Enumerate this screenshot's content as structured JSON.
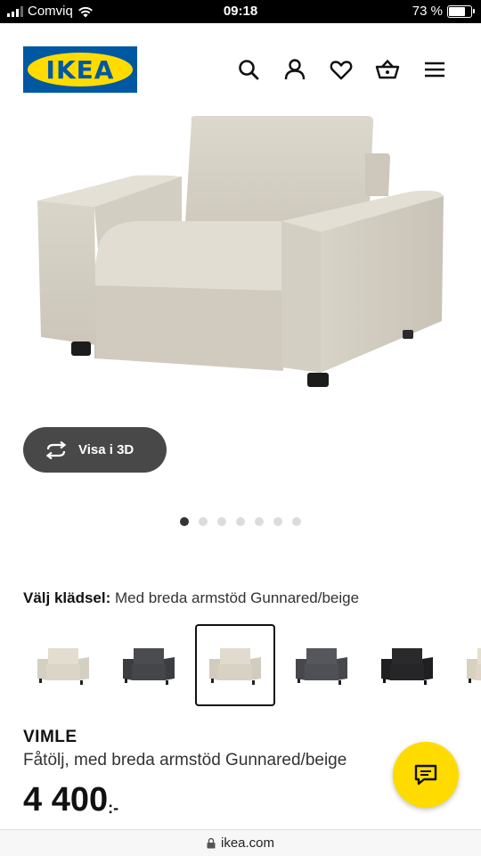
{
  "status_bar": {
    "carrier": "Comviq",
    "time": "09:18",
    "battery_percent": "73 %",
    "battery_level": 0.73
  },
  "header": {
    "logo_text": "IKEA",
    "icons": [
      "search-icon",
      "user-icon",
      "heart-icon",
      "basket-icon",
      "menu-icon"
    ]
  },
  "gallery": {
    "view_3d_label": "Visa i 3D",
    "image_count": 7,
    "active_index": 0
  },
  "fabric": {
    "label": "Välj klädsel:",
    "value": "Med breda armstöd Gunnared/beige",
    "swatches": [
      {
        "name": "beige",
        "color": "#e3ddd0"
      },
      {
        "name": "dark-grey",
        "color": "#4a4c50"
      },
      {
        "name": "beige",
        "color": "#e0dbce",
        "selected": true
      },
      {
        "name": "grey",
        "color": "#55575d"
      },
      {
        "name": "black",
        "color": "#2a2a2c"
      },
      {
        "name": "beige",
        "color": "#e6dfcf"
      }
    ]
  },
  "product": {
    "name": "VIMLE",
    "description": "Fåtölj, med breda armstöd Gunnared/beige",
    "price_main": "4 400",
    "price_decimal": ":-"
  },
  "browser": {
    "url": "ikea.com"
  },
  "colors": {
    "ikea_blue": "#0058a3",
    "ikea_yellow": "#ffdb00",
    "button_dark": "#484848"
  }
}
